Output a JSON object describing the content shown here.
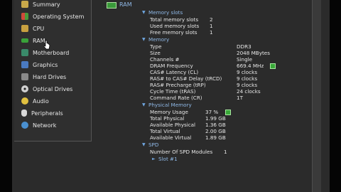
{
  "sidebar": {
    "items": [
      {
        "label": "Summary",
        "icon": "summary-icon",
        "color": "#c9a94a"
      },
      {
        "label": "Operating System",
        "icon": "windows-icon",
        "color": "#d04a3a"
      },
      {
        "label": "CPU",
        "icon": "cpu-icon",
        "color": "#c8a040"
      },
      {
        "label": "RAM",
        "icon": "ram-icon",
        "color": "#3aa23a"
      },
      {
        "label": "Motherboard",
        "icon": "motherboard-icon",
        "color": "#3a8a6a"
      },
      {
        "label": "Graphics",
        "icon": "graphics-icon",
        "color": "#4a7ac0"
      },
      {
        "label": "Hard Drives",
        "icon": "hard-drive-icon",
        "color": "#8a8a8a"
      },
      {
        "label": "Optical Drives",
        "icon": "optical-drive-icon",
        "color": "#d0d0d0"
      },
      {
        "label": "Audio",
        "icon": "audio-icon",
        "color": "#e0c040"
      },
      {
        "label": "Peripherals",
        "icon": "peripherals-icon",
        "color": "#d8d8d8"
      },
      {
        "label": "Network",
        "icon": "network-icon",
        "color": "#4a90d0"
      }
    ]
  },
  "content": {
    "title": "RAM",
    "memory_slots": {
      "header": "Memory slots",
      "rows": [
        {
          "label": "Total memory slots",
          "value": "2"
        },
        {
          "label": "Used memory slots",
          "value": "1"
        },
        {
          "label": "Free memory slots",
          "value": "1"
        }
      ]
    },
    "memory": {
      "header": "Memory",
      "rows": [
        {
          "label": "Type",
          "value": "DDR3"
        },
        {
          "label": "Size",
          "value": "2048 MBytes"
        },
        {
          "label": "Channels #",
          "value": "Single"
        },
        {
          "label": "DRAM Frequency",
          "value": "669.4 MHz"
        },
        {
          "label": "CAS# Latency (CL)",
          "value": "9 clocks"
        },
        {
          "label": "RAS# to CAS# Delay (tRCD)",
          "value": "9 clocks"
        },
        {
          "label": "RAS# Precharge (tRP)",
          "value": "9 clocks"
        },
        {
          "label": "Cycle Time (tRAS)",
          "value": "24 clocks"
        },
        {
          "label": "Command Rate (CR)",
          "value": "1T"
        }
      ]
    },
    "physical_memory": {
      "header": "Physical Memory",
      "rows": [
        {
          "label": "Memory Usage",
          "value": "37 %"
        },
        {
          "label": "Total Physical",
          "value": "1.99 GB"
        },
        {
          "label": "Available Physical",
          "value": "1.36 GB"
        },
        {
          "label": "Total Virtual",
          "value": "2.00 GB"
        },
        {
          "label": "Available Virtual",
          "value": "1.89 GB"
        }
      ]
    },
    "spd": {
      "header": "SPD",
      "rows": [
        {
          "label": "Number Of SPD Modules",
          "value": "1"
        }
      ],
      "slot": "Slot #1"
    }
  }
}
